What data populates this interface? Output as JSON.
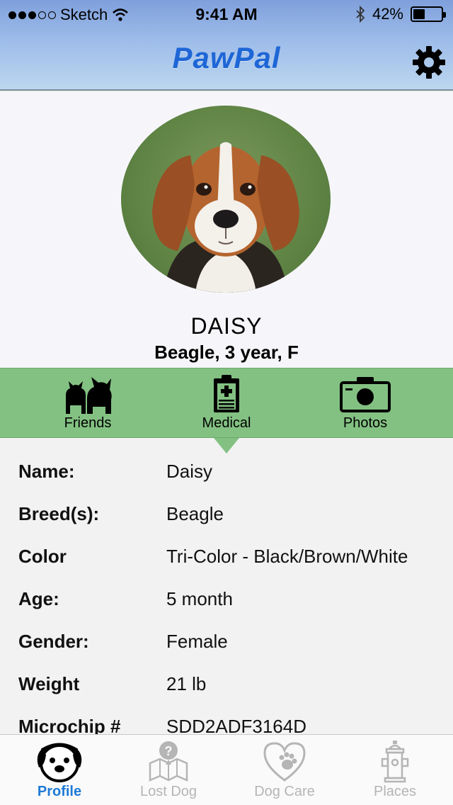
{
  "status_bar": {
    "carrier": "Sketch",
    "time": "9:41 AM",
    "battery_percent": "42%",
    "battery_level": 0.42,
    "bluetooth_icon": "bluetooth-icon",
    "wifi_icon": "wifi-icon"
  },
  "nav": {
    "title": "PawPal",
    "settings_icon": "gear-icon",
    "title_color": "#1e66d6"
  },
  "profile": {
    "name": "DAISY",
    "subtitle": "Beagle, 3 year, F",
    "photo_icon": "dog-photo"
  },
  "section_tabs": [
    {
      "label": "Friends",
      "icon": "friends-icon"
    },
    {
      "label": "Medical",
      "icon": "clipboard-icon"
    },
    {
      "label": "Photos",
      "icon": "camera-icon"
    }
  ],
  "details": [
    {
      "label": "Name:",
      "value": "Daisy"
    },
    {
      "label": "Breed(s):",
      "value": "Beagle"
    },
    {
      "label": "Color",
      "value": "Tri-Color - Black/Brown/White"
    },
    {
      "label": "Age:",
      "value": "5 month"
    },
    {
      "label": "Gender:",
      "value": "Female"
    },
    {
      "label": "Weight",
      "value": "21 lb"
    },
    {
      "label": "Microchip #",
      "value": "SDD2ADF3164D"
    }
  ],
  "tabbar": [
    {
      "label": "Profile",
      "icon": "dog-face-icon",
      "active": true
    },
    {
      "label": "Lost Dog",
      "icon": "map-question-icon",
      "active": false
    },
    {
      "label": "Dog Care",
      "icon": "heart-paw-icon",
      "active": false
    },
    {
      "label": "Places",
      "icon": "fire-hydrant-icon",
      "active": false
    }
  ],
  "colors": {
    "accent_green": "#83c183",
    "active_tab": "#1f7ad6",
    "inactive_tab": "#b5b5b5"
  }
}
